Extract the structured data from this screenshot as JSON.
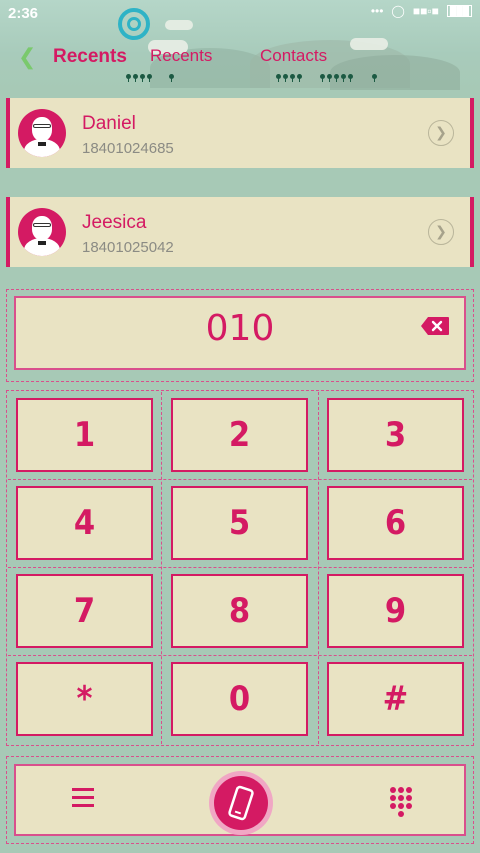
{
  "status_bar": {
    "time": "2:36",
    "icons": [
      "notification-dots-icon",
      "alarm-icon",
      "signal-icon",
      "battery-icon"
    ]
  },
  "header": {
    "tabs": [
      {
        "label": "Recents",
        "active": true
      },
      {
        "label": "Recents",
        "active": false
      },
      {
        "label": "Contacts",
        "active": false
      }
    ]
  },
  "contacts": [
    {
      "name": "Daniel",
      "number": "18401024685"
    },
    {
      "name": "Jeesica",
      "number": "18401025042"
    }
  ],
  "dialer": {
    "input": "010"
  },
  "keypad": [
    "1",
    "2",
    "3",
    "4",
    "5",
    "6",
    "7",
    "8",
    "9",
    "*",
    "0",
    "#"
  ],
  "colors": {
    "accent": "#d41a63",
    "card": "#e9e3c3",
    "background": "#a7c9b6"
  }
}
